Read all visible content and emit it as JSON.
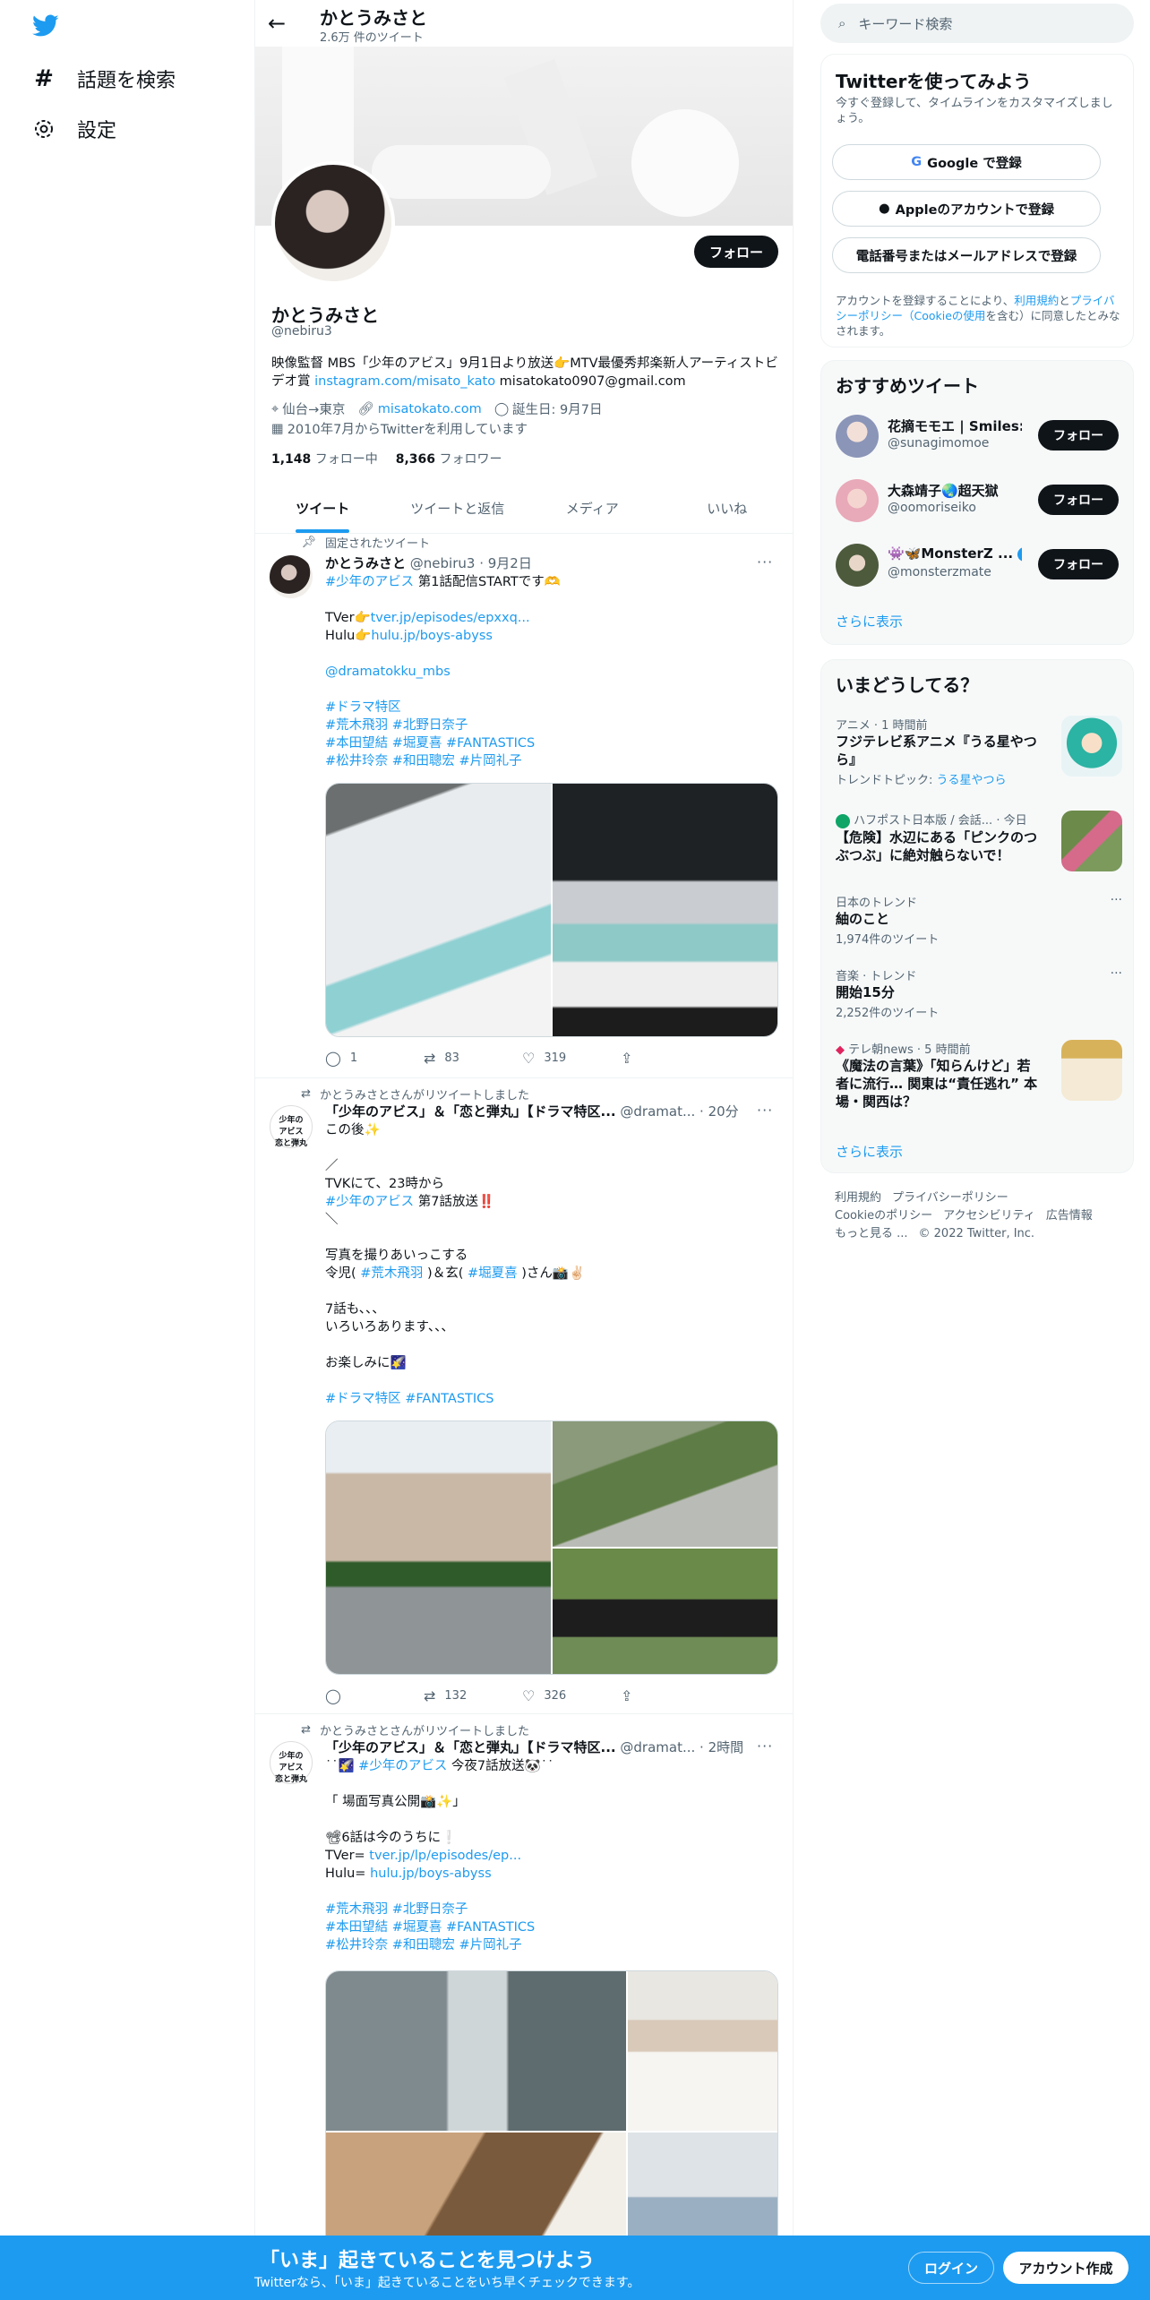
{
  "left_nav": {
    "items": [
      {
        "label": "話題を検索",
        "icon": "hash-icon"
      },
      {
        "label": "設定",
        "icon": "gear-icon"
      }
    ]
  },
  "header": {
    "title": "かとうみさと",
    "subtitle": "2.6万 件のツイート"
  },
  "profile": {
    "follow_label": "フォロー",
    "name": "かとうみさと",
    "handle": "@nebiru3",
    "bio_text": "映像監督 MBS「少年のアビス」9月1日より放送👉MTV最優秀邦楽新人アーティストビデオ賞 ",
    "bio_link": "instagram.com/misato_kato",
    "bio_email": " misatokato0907@gmail.com",
    "location": "仙台→東京",
    "website": "misatokato.com",
    "birthday": "誕生日: 9月7日",
    "joined": "2010年7月からTwitterを利用しています",
    "following_count": "1,148",
    "following_label": "フォロー中",
    "followers_count": "8,366",
    "followers_label": "フォロワー"
  },
  "tabs": [
    "ツイート",
    "ツイートと返信",
    "メディア",
    "いいね"
  ],
  "tweets": [
    {
      "context": "固定されたツイート",
      "name": "かとうみさと",
      "meta": "@nebiru3 · 9月2日",
      "body_lines": [
        {
          "text": "",
          "parts": [
            {
              "t": "#少年のアビス",
              "link": true
            },
            {
              "t": " 第1話配信STARTです🫶",
              "link": false
            }
          ]
        },
        {
          "text": "",
          "parts": [
            {
              "t": " ",
              "link": false
            }
          ]
        },
        {
          "text": "",
          "parts": [
            {
              "t": "TVer👉",
              "link": false
            },
            {
              "t": "tver.jp/episodes/epxxq...",
              "link": true
            }
          ]
        },
        {
          "text": "",
          "parts": [
            {
              "t": "Hulu👉",
              "link": false
            },
            {
              "t": "hulu.jp/boys-abyss",
              "link": true
            }
          ]
        },
        {
          "text": "",
          "parts": [
            {
              "t": " ",
              "link": false
            }
          ]
        },
        {
          "text": "",
          "parts": [
            {
              "t": "@dramatokku_mbs",
              "link": true
            }
          ]
        },
        {
          "text": "",
          "parts": [
            {
              "t": " ",
              "link": false
            }
          ]
        },
        {
          "text": "",
          "parts": [
            {
              "t": "#ドラマ特区",
              "link": true
            }
          ]
        },
        {
          "text": "",
          "parts": [
            {
              "t": "#荒木飛羽 #北野日奈子",
              "link": true
            }
          ]
        },
        {
          "text": "",
          "parts": [
            {
              "t": "#本田望結 #堀夏喜 #FANTASTICS",
              "link": true
            }
          ]
        },
        {
          "text": "",
          "parts": [
            {
              "t": "#松井玲奈 #和田聰宏 #片岡礼子",
              "link": true
            }
          ]
        }
      ],
      "reply": "1",
      "retweet": "83",
      "like": "319"
    },
    {
      "context": "かとうみさとさんがリツイートしました",
      "name": "「少年のアビス」＆「恋と弾丸」【ドラマ特区...",
      "meta": "@dramat... · 20分",
      "body_lines": [
        {
          "parts": [
            {
              "t": "この後✨",
              "link": false
            }
          ]
        },
        {
          "parts": [
            {
              "t": " ",
              "link": false
            }
          ]
        },
        {
          "parts": [
            {
              "t": "／",
              "link": false
            }
          ]
        },
        {
          "parts": [
            {
              "t": "TVKにて、23時から",
              "link": false
            }
          ]
        },
        {
          "parts": [
            {
              "t": "#少年のアビス",
              "link": true
            },
            {
              "t": " 第7話放送‼️",
              "link": false
            }
          ]
        },
        {
          "parts": [
            {
              "t": "＼",
              "link": false
            }
          ]
        },
        {
          "parts": [
            {
              "t": " ",
              "link": false
            }
          ]
        },
        {
          "parts": [
            {
              "t": "写真を撮りあいっこする",
              "link": false
            }
          ]
        },
        {
          "parts": [
            {
              "t": "令児( ",
              "link": false
            },
            {
              "t": "#荒木飛羽",
              "link": true
            },
            {
              "t": " )＆玄( ",
              "link": false
            },
            {
              "t": "#堀夏喜",
              "link": true
            },
            {
              "t": " )さん📸✌🏻",
              "link": false
            }
          ]
        },
        {
          "parts": [
            {
              "t": " ",
              "link": false
            }
          ]
        },
        {
          "parts": [
            {
              "t": "7話も、、、",
              "link": false
            }
          ]
        },
        {
          "parts": [
            {
              "t": "いろいろあります、、、",
              "link": false
            }
          ]
        },
        {
          "parts": [
            {
              "t": " ",
              "link": false
            }
          ]
        },
        {
          "parts": [
            {
              "t": "お楽しみに🌠",
              "link": false
            }
          ]
        },
        {
          "parts": [
            {
              "t": " ",
              "link": false
            }
          ]
        },
        {
          "parts": [
            {
              "t": "#ドラマ特区 #FANTASTICS",
              "link": true
            }
          ]
        }
      ],
      "reply": "",
      "retweet": "132",
      "like": "326"
    },
    {
      "context": "かとうみさとさんがリツイートしました",
      "name": "「少年のアビス」＆「恋と弾丸」【ドラマ特区...",
      "meta": "@dramat... · 2時間",
      "body_lines": [
        {
          "parts": [
            {
              "t": "˙˙🌠 ",
              "link": false
            },
            {
              "t": "#少年のアビス",
              "link": true
            },
            {
              "t": " 今夜7話放送🐼˙˙",
              "link": false
            }
          ]
        },
        {
          "parts": [
            {
              "t": " ",
              "link": false
            }
          ]
        },
        {
          "parts": [
            {
              "t": "「 場面写真公開📸✨」",
              "link": false
            }
          ]
        },
        {
          "parts": [
            {
              "t": " ",
              "link": false
            }
          ]
        },
        {
          "parts": [
            {
              "t": "📽6話は今のうちに❕",
              "link": false
            }
          ]
        },
        {
          "parts": [
            {
              "t": "TVer= ",
              "link": false
            },
            {
              "t": "tver.jp/lp/episodes/ep...",
              "link": true
            }
          ]
        },
        {
          "parts": [
            {
              "t": "Hulu= ",
              "link": false
            },
            {
              "t": "hulu.jp/boys-abyss",
              "link": true
            }
          ]
        },
        {
          "parts": [
            {
              "t": " ",
              "link": false
            }
          ]
        },
        {
          "parts": [
            {
              "t": "#荒木飛羽 #北野日奈子",
              "link": true
            }
          ]
        },
        {
          "parts": [
            {
              "t": "#本田望結 #堀夏喜 #FANTASTICS",
              "link": true
            }
          ]
        },
        {
          "parts": [
            {
              "t": "#松井玲奈 #和田聰宏 #片岡礼子",
              "link": true
            }
          ]
        }
      ]
    }
  ],
  "search": {
    "placeholder": "キーワード検索"
  },
  "signup": {
    "title": "Twitterを使ってみよう",
    "desc": "今すぐ登録して、タイムラインをカスタマイズしましょう。",
    "google": "Google で登録",
    "apple": "Appleのアカウントで登録",
    "phone": "電話番号またはメールアドレスで登録",
    "legal_1": "アカウントを登録することにより、",
    "legal_terms": "利用規約",
    "legal_2": "と",
    "legal_privacy": "プライバシーポリシー（Cookieの使用",
    "legal_3": "を含む）に同意したとみなされます。"
  },
  "recommended": {
    "title": "おすすめツイート",
    "users": [
      {
        "name": "花摘モモエ | Smiles:",
        "handle": "@sunagimomoe"
      },
      {
        "name": "大森靖子🌏超天獄",
        "handle": "@oomoriseiko"
      },
      {
        "name": "👾🦋MonsterZ ...",
        "handle": "@monsterzmate"
      }
    ],
    "follow_label": "フォロー",
    "show_more": "さらに表示"
  },
  "trends": {
    "title": "いまどうしてる？",
    "items": [
      {
        "meta": "アニメ · 1 時間前",
        "title": "フジテレビ系アニメ『うる星やつら』",
        "sub_prefix": "トレンドトピック: ",
        "sub_link": "うる星やつら"
      },
      {
        "meta": "ハフポスト日本版 / 会話... · 今日",
        "title": "【危険】水辺にある「ピンクのつぶつぶ」に絶対触らないで！"
      },
      {
        "meta": "日本のトレンド",
        "title": "紬のこと",
        "sub": "1,974件のツイート"
      },
      {
        "meta": "音楽 · トレンド",
        "title": "開始15分",
        "sub": "2,252件のツイート"
      },
      {
        "meta": "テレ朝news · 5 時間前",
        "title": "《魔法の言葉》「知らんけど」若者に流行… 関東は“責任逃れ” 本場・関西は？"
      }
    ],
    "show_more": "さらに表示"
  },
  "footer": {
    "links": [
      "利用規約",
      "プライバシーポリシー",
      "Cookieのポリシー",
      "アクセシビリティ",
      "広告情報",
      "もっと見る ...",
      "© 2022 Twitter, Inc."
    ]
  },
  "bottom_bar": {
    "title": "「いま」起きていることを見つけよう",
    "sub": "Twitterなら、「いま」起きていることをいち早くチェックできます。",
    "login": "ログイン",
    "signup": "アカウント作成"
  },
  "colors": {
    "accent": "#1d9bf0",
    "text": "#0f1419",
    "muted": "#536471"
  }
}
